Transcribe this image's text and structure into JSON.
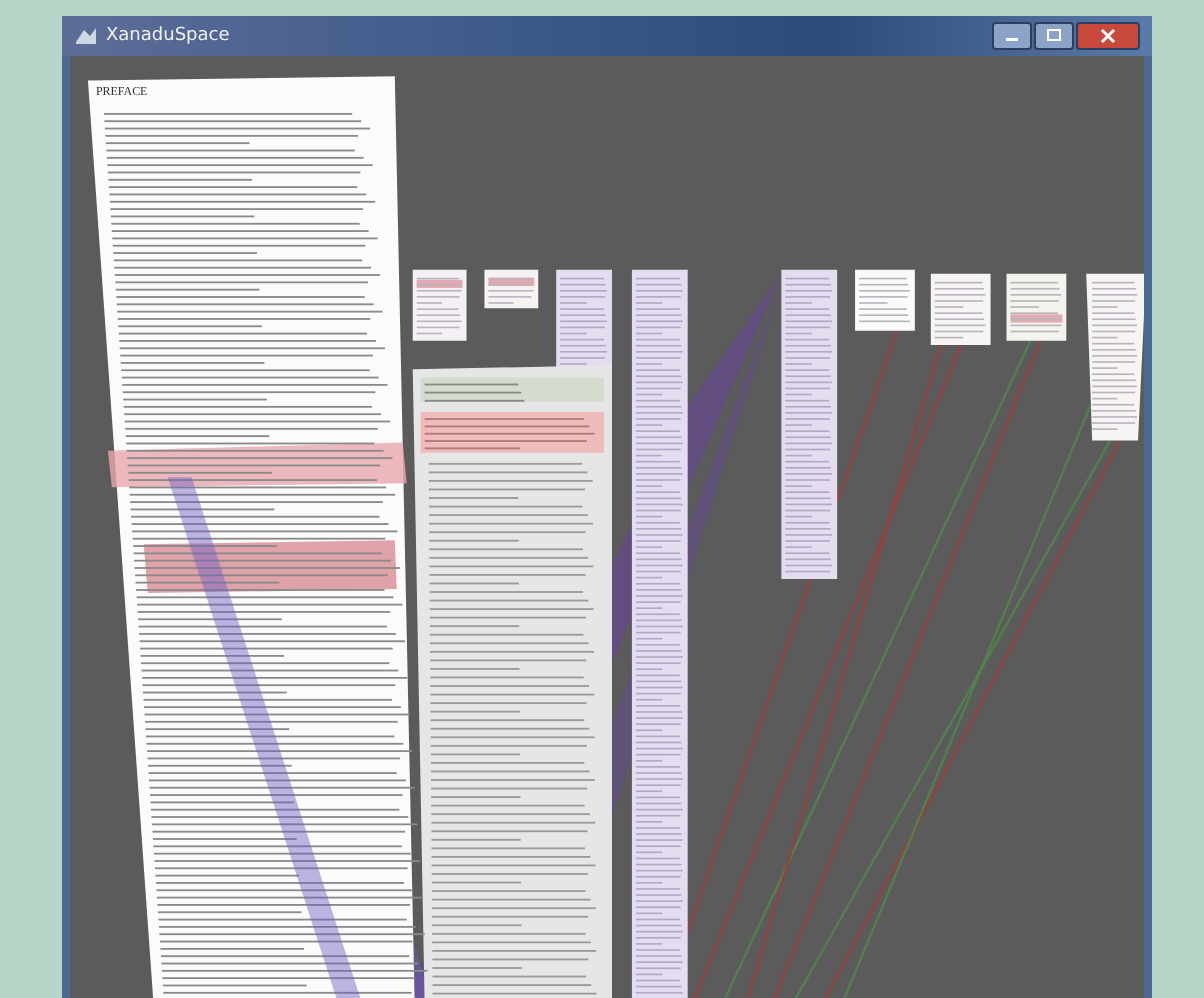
{
  "window": {
    "title": "XanaduSpace"
  },
  "document": {
    "heading": "PREFACE"
  }
}
